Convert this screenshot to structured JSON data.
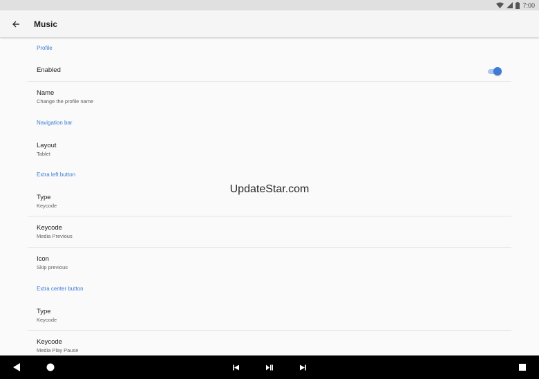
{
  "status_bar": {
    "time": "7:00"
  },
  "toolbar": {
    "title": "Music"
  },
  "sections": {
    "profile": "Profile",
    "navigation_bar": "Navigation bar",
    "extra_left_button": "Extra left button",
    "extra_center_button": "Extra center button"
  },
  "settings": {
    "enabled": {
      "title": "Enabled",
      "value": true
    },
    "name": {
      "title": "Name",
      "summary": "Change the profile name"
    },
    "layout": {
      "title": "Layout",
      "summary": "Tablet"
    },
    "left_type": {
      "title": "Type",
      "summary": "Keycode"
    },
    "left_keycode": {
      "title": "Keycode",
      "summary": "Media Previous"
    },
    "left_icon": {
      "title": "Icon",
      "summary": "Skip previous"
    },
    "center_type": {
      "title": "Type",
      "summary": "Keycode"
    },
    "center_keycode": {
      "title": "Keycode",
      "summary": "Media Play Pause"
    }
  },
  "watermark": "UpdateStar.com",
  "colors": {
    "accent": "#3d7bd6",
    "accent_track": "#a9c5f0",
    "toolbar_bg": "#f5f5f5",
    "statusbar_bg": "#e0e0e0"
  },
  "icons": {
    "back": "arrow-left-icon",
    "wifi": "wifi-icon",
    "signal": "cell-signal-icon",
    "battery": "battery-icon",
    "nav_back": "triangle-back-icon",
    "nav_home": "circle-home-icon",
    "nav_recents": "square-recents-icon",
    "skip_previous": "skip-previous-icon",
    "play_pause": "play-pause-icon",
    "skip_next": "skip-next-icon"
  }
}
